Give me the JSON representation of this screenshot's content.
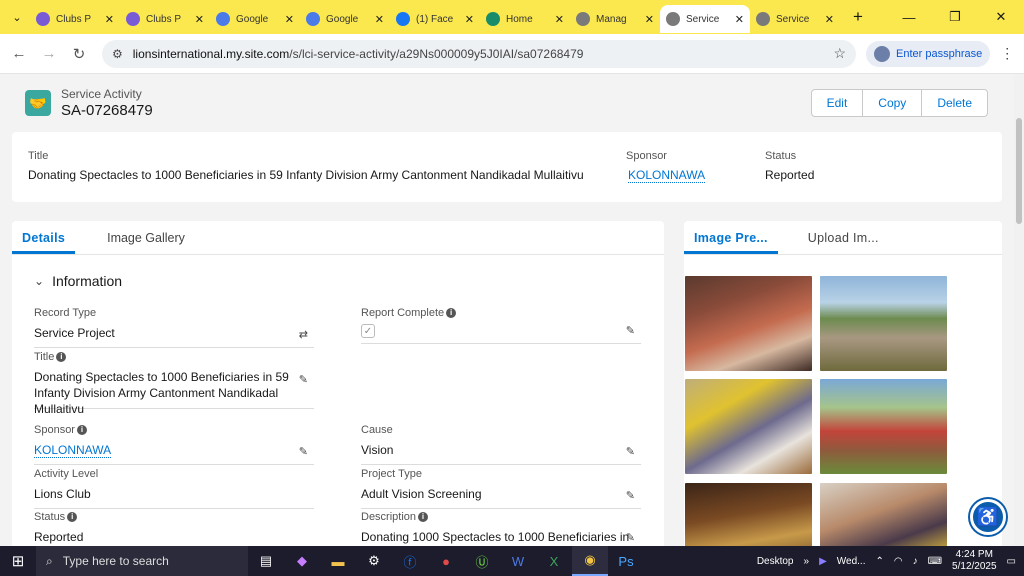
{
  "browser": {
    "tabs": [
      {
        "label": "Clubs P",
        "icon": "lions-icon",
        "color": "#7a5bd6"
      },
      {
        "label": "Clubs P",
        "icon": "lions-icon",
        "color": "#7a5bd6"
      },
      {
        "label": "Google",
        "icon": "google-sheets-icon",
        "color": "#4a7be8"
      },
      {
        "label": "Google",
        "icon": "google-sheets-icon",
        "color": "#4a7be8"
      },
      {
        "label": "(1) Face",
        "icon": "facebook-icon",
        "color": "#1877f2"
      },
      {
        "label": "Home",
        "icon": "lions-icon",
        "color": "#1a8c6a"
      },
      {
        "label": "Manag",
        "icon": "globe-icon",
        "color": "#7a7a7a"
      },
      {
        "label": "Service",
        "icon": "globe-icon",
        "color": "#7a7a7a"
      },
      {
        "label": "Service",
        "icon": "globe-icon",
        "color": "#7a7a7a"
      }
    ],
    "active_tab": 7,
    "url_host": "lionsinternational.my.site.com",
    "url_path": "/s/lci-service-activity/a29Ns000009y5J0IAI/sa07268479",
    "profile_label": "Enter passphrase"
  },
  "record": {
    "object_label": "Service Activity",
    "name": "SA-07268479",
    "buttons": {
      "edit": "Edit",
      "copy": "Copy",
      "delete": "Delete"
    }
  },
  "highlights": {
    "title_label": "Title",
    "title_value": "Donating Spectacles to 1000 Beneficiaries in 59 Infanty Division Army Cantonment Nandikadal Mullaitivu",
    "sponsor_label": "Sponsor",
    "sponsor_value": "KOLONNAWA",
    "status_label": "Status",
    "status_value": "Reported"
  },
  "detail_tabs": {
    "details": "Details",
    "gallery": "Image Gallery"
  },
  "section_title": "Information",
  "fields": {
    "record_type": {
      "label": "Record Type",
      "value": "Service Project"
    },
    "report_complete": {
      "label": "Report Complete"
    },
    "title": {
      "label": "Title",
      "value": "Donating Spectacles to 1000 Beneficiaries in 59 Infanty Division Army Cantonment Nandikadal Mullaitivu"
    },
    "sponsor": {
      "label": "Sponsor",
      "value": "KOLONNAWA"
    },
    "cause": {
      "label": "Cause",
      "value": "Vision"
    },
    "activity_level": {
      "label": "Activity Level",
      "value": "Lions Club"
    },
    "project_type": {
      "label": "Project Type",
      "value": "Adult Vision Screening"
    },
    "status": {
      "label": "Status",
      "value": "Reported"
    },
    "description": {
      "label": "Description",
      "value": "Donating 1000 Spectacles to 1000 Beneficiaries in"
    }
  },
  "image_tabs": {
    "preview": "Image Pre...",
    "upload": "Upload Im..."
  },
  "taskbar": {
    "search_placeholder": "Type here to search",
    "desktop_label": "Desktop",
    "weather_label": "Wed...",
    "time": "4:24 PM",
    "date": "5/12/2025"
  }
}
